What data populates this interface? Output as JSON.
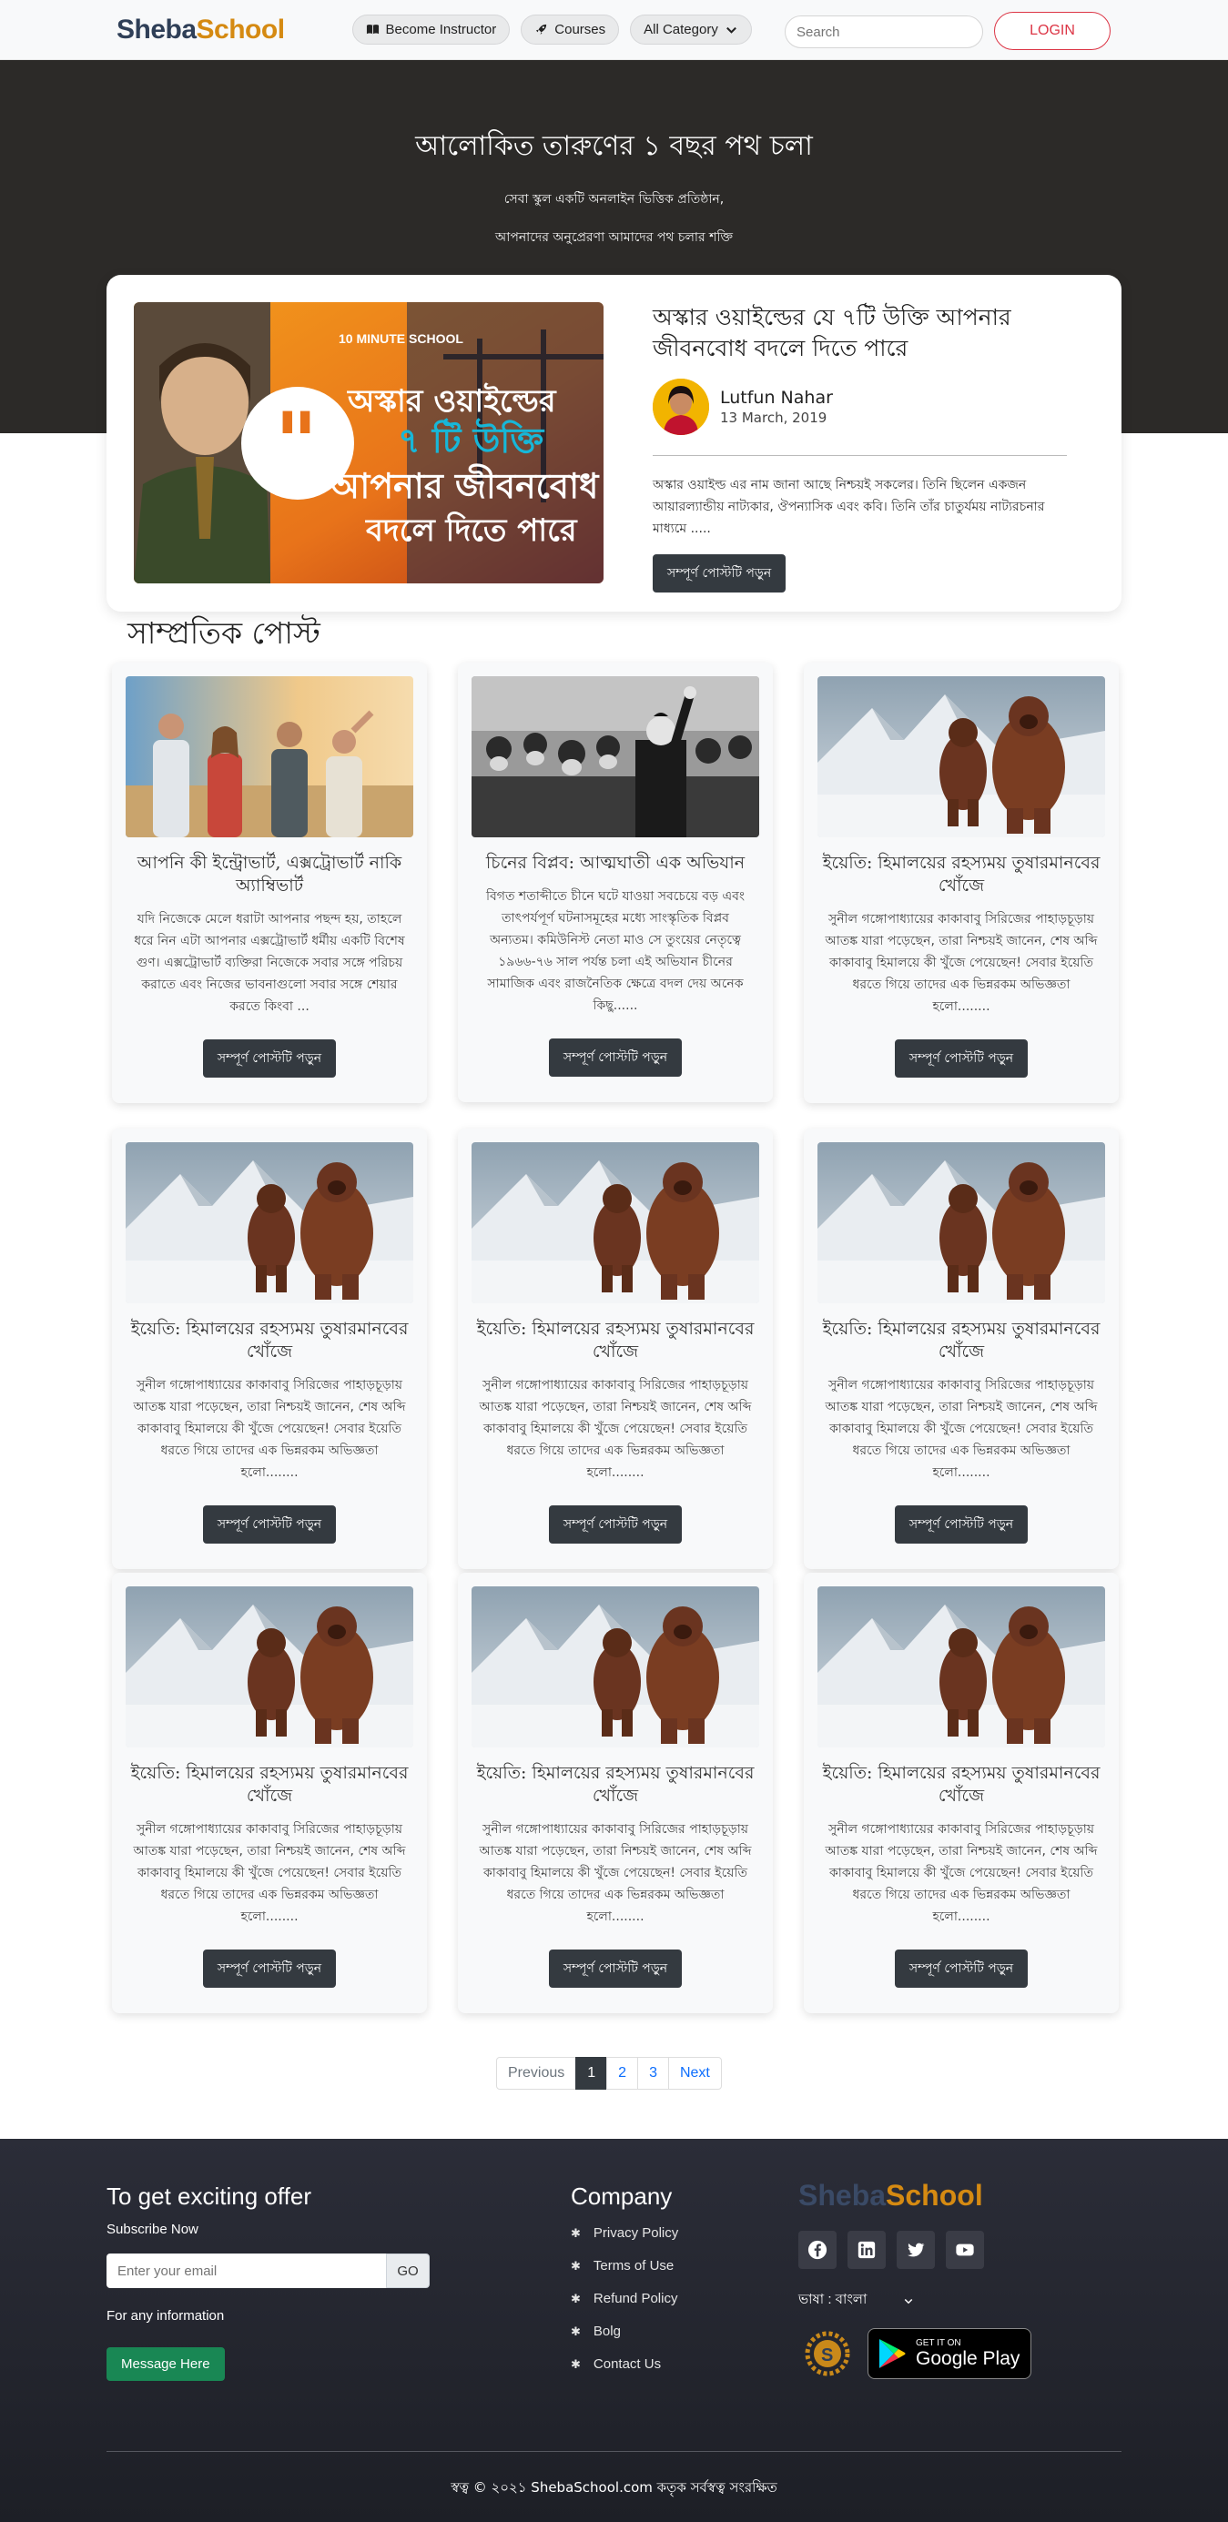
{
  "nav": {
    "logo_part1": "Sheba",
    "logo_part2": "School",
    "become_instructor": "Become Instructor",
    "courses": "Courses",
    "all_category": "All Category",
    "search_placeholder": "Search",
    "login": "LOGIN"
  },
  "hero": {
    "title": "আলোকিত তারুণের ১ বছর পথ চলা",
    "line1": "সেবা স্কুল একটি অনলাইন ভিত্তিক প্রতিষ্ঠান,",
    "line2": "আপনাদের অনুপ্রেরণা আমাদের পথ চলার শক্তি"
  },
  "featured": {
    "title": "অস্কার ওয়াইল্ডের যে ৭টি উক্তি আপনার জীবনবোধ বদলে দিতে পারে",
    "author": "Lutfun Nahar",
    "date": "13 March, 2019",
    "excerpt": "অস্কার ওয়াইল্ড এর নাম জানা আছে নিশ্চয়ই সকলের। তিনি ছিলেন একজন আয়ারল্যান্ডীয় নাট্যকার, ঔপন্যাসিক এবং কবি। তিনি তাঁর চাতুর্যময় নাট্যরচনার মাধ্যমে .....",
    "button": "সম্পূর্ণ পোস্টটি পড়ুন",
    "image_badge": "10 MINUTE SCHOOL",
    "image_text1": "অস্কার ওয়াইল্ডের",
    "image_text2": "৭ টি উক্তি",
    "image_text3": "আপনার জীবনবোধ",
    "image_text4": "বদলে দিতে পারে"
  },
  "recent": {
    "title": "সাম্প্রতিক পোস্ট",
    "button": "সম্পূর্ণ পোস্টটি পড়ুন",
    "posts": [
      {
        "title": "আপনি কী ইন্ট্রোভার্ট, এক্সট্রোভার্ট নাকি অ্যাম্বিভার্ট",
        "text": "যদি নিজেকে মেলে ধরাটা আপনার পছন্দ হয়, তাহলে ধরে নিন এটা আপনার এক্সট্রোভার্ট ধর্মীয় একটি বিশেষ গুণ। এক্সট্রোভার্ট ব্যক্তিরা নিজেকে সবার সঙ্গে পরিচয় করাতে এবং নিজের ভাবনাগুলো সবার সঙ্গে শেয়ার করতে কিংবা ...",
        "image": "friends"
      },
      {
        "title": "চিনের বিপ্লব: আত্মঘাতী এক অভিযান",
        "text": "বিগত শতাব্দীতে চীনে ঘটে যাওয়া সবচেয়ে বড় এবং তাৎপর্যপূর্ণ ঘটনাসমূহের মধ্যে সাংস্কৃতিক বিপ্লব অন্যতম। কমিউনিস্ট নেতা মাও সে তুংয়ের নেতৃত্বে ১৯৬৬-৭৬ সাল পর্যন্ত চলা এই অভিযান চীনের সামাজিক এবং রাজনৈতিক ক্ষেত্রে বদল দেয় অনেক কিছু......",
        "image": "crowd"
      },
      {
        "title": "ইয়েতি: হিমালয়ের রহস্যময় তুষারমানবের খোঁজে",
        "text": "সুনীল গঙ্গোপাধ্যায়ের কাকাবাবু সিরিজের পাহাড়চূড়ায় আতঙ্ক যারা পড়েছেন, তারা নিশ্চয়ই জানেন, শেষ অব্দি কাকাবাবু হিমালয়ে কী খুঁজে পেয়েছেন! সেবার ইয়েতি ধরতে গিয়ে তাদের এক ভিন্নরকম অভিজ্ঞতা হলো........",
        "image": "yeti"
      },
      {
        "title": "ইয়েতি: হিমালয়ের রহস্যময় তুষারমানবের খোঁজে",
        "text": "সুনীল গঙ্গোপাধ্যায়ের কাকাবাবু সিরিজের পাহাড়চূড়ায় আতঙ্ক যারা পড়েছেন, তারা নিশ্চয়ই জানেন, শেষ অব্দি কাকাবাবু হিমালয়ে কী খুঁজে পেয়েছেন! সেবার ইয়েতি ধরতে গিয়ে তাদের এক ভিন্নরকম অভিজ্ঞতা হলো........",
        "image": "yeti"
      },
      {
        "title": "ইয়েতি: হিমালয়ের রহস্যময় তুষারমানবের খোঁজে",
        "text": "সুনীল গঙ্গোপাধ্যায়ের কাকাবাবু সিরিজের পাহাড়চূড়ায় আতঙ্ক যারা পড়েছেন, তারা নিশ্চয়ই জানেন, শেষ অব্দি কাকাবাবু হিমালয়ে কী খুঁজে পেয়েছেন! সেবার ইয়েতি ধরতে গিয়ে তাদের এক ভিন্নরকম অভিজ্ঞতা হলো........",
        "image": "yeti"
      },
      {
        "title": "ইয়েতি: হিমালয়ের রহস্যময় তুষারমানবের খোঁজে",
        "text": "সুনীল গঙ্গোপাধ্যায়ের কাকাবাবু সিরিজের পাহাড়চূড়ায় আতঙ্ক যারা পড়েছেন, তারা নিশ্চয়ই জানেন, শেষ অব্দি কাকাবাবু হিমালয়ে কী খুঁজে পেয়েছেন! সেবার ইয়েতি ধরতে গিয়ে তাদের এক ভিন্নরকম অভিজ্ঞতা হলো........",
        "image": "yeti"
      },
      {
        "title": "ইয়েতি: হিমালয়ের রহস্যময় তুষারমানবের খোঁজে",
        "text": "সুনীল গঙ্গোপাধ্যায়ের কাকাবাবু সিরিজের পাহাড়চূড়ায় আতঙ্ক যারা পড়েছেন, তারা নিশ্চয়ই জানেন, শেষ অব্দি কাকাবাবু হিমালয়ে কী খুঁজে পেয়েছেন! সেবার ইয়েতি ধরতে গিয়ে তাদের এক ভিন্নরকম অভিজ্ঞতা হলো........",
        "image": "yeti"
      },
      {
        "title": "ইয়েতি: হিমালয়ের রহস্যময় তুষারমানবের খোঁজে",
        "text": "সুনীল গঙ্গোপাধ্যায়ের কাকাবাবু সিরিজের পাহাড়চূড়ায় আতঙ্ক যারা পড়েছেন, তারা নিশ্চয়ই জানেন, শেষ অব্দি কাকাবাবু হিমালয়ে কী খুঁজে পেয়েছেন! সেবার ইয়েতি ধরতে গিয়ে তাদের এক ভিন্নরকম অভিজ্ঞতা হলো........",
        "image": "yeti"
      },
      {
        "title": "ইয়েতি: হিমালয়ের রহস্যময় তুষারমানবের খোঁজে",
        "text": "সুনীল গঙ্গোপাধ্যায়ের কাকাবাবু সিরিজের পাহাড়চূড়ায় আতঙ্ক যারা পড়েছেন, তারা নিশ্চয়ই জানেন, শেষ অব্দি কাকাবাবু হিমালয়ে কী খুঁজে পেয়েছেন! সেবার ইয়েতি ধরতে গিয়ে তাদের এক ভিন্নরকম অভিজ্ঞতা হলো........",
        "image": "yeti"
      }
    ]
  },
  "pagination": {
    "previous": "Previous",
    "pages": [
      "1",
      "2",
      "3"
    ],
    "active": "1",
    "next": "Next"
  },
  "footer": {
    "offer_title": "To get exciting offer",
    "subscribe": "Subscribe Now",
    "email_placeholder": "Enter your email",
    "go": "GO",
    "info": "For any information",
    "message_button": "Message Here",
    "company_title": "Company",
    "links": [
      "Privacy Policy",
      "Terms of Use",
      "Refund Policy",
      "Bolg",
      "Contact Us"
    ],
    "logo_part1": "Sheba",
    "logo_part2": "School",
    "socials": [
      "facebook-icon",
      "linkedin-icon",
      "twitter-icon",
      "youtube-icon"
    ],
    "language": "ভাষা : বাংলা",
    "gplay_line1": "GET IT ON",
    "gplay_line2": "Google Play",
    "copyright": "স্বত্ব © ২০২১ ShebaSchool.com কতৃক সর্বস্বত্ব সংরক্ষিত"
  },
  "colors": {
    "hero_bg": "#2c2a28",
    "footer_bg": "#23252e",
    "brand_dark": "#2f3f57",
    "brand_orange": "#d58a12",
    "login_red": "#dc3545",
    "button_dark": "#343a40",
    "message_green": "#198754"
  }
}
